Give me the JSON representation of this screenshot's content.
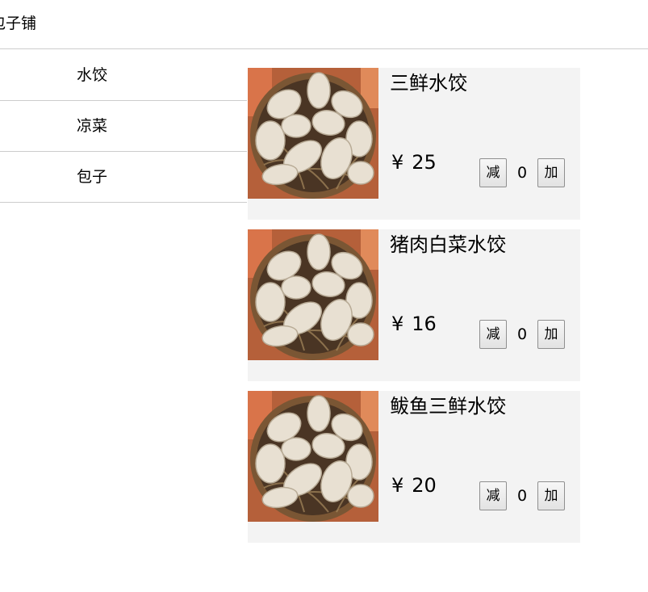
{
  "header": {
    "title": "包子铺"
  },
  "sidebar": {
    "categories": [
      {
        "label": "水饺"
      },
      {
        "label": "凉菜"
      },
      {
        "label": "包子"
      }
    ]
  },
  "products": [
    {
      "name": "三鲜水饺",
      "currency": "¥",
      "price": "25",
      "minus_label": "减",
      "quantity": "0",
      "plus_label": "加"
    },
    {
      "name": "猪肉白菜水饺",
      "currency": "¥",
      "price": "16",
      "minus_label": "减",
      "quantity": "0",
      "plus_label": "加"
    },
    {
      "name": "鲅鱼三鲜水饺",
      "currency": "¥",
      "price": "20",
      "minus_label": "减",
      "quantity": "0",
      "plus_label": "加"
    }
  ],
  "colors": {
    "card_background": "#f3f3f3",
    "divider": "#cccccc"
  }
}
